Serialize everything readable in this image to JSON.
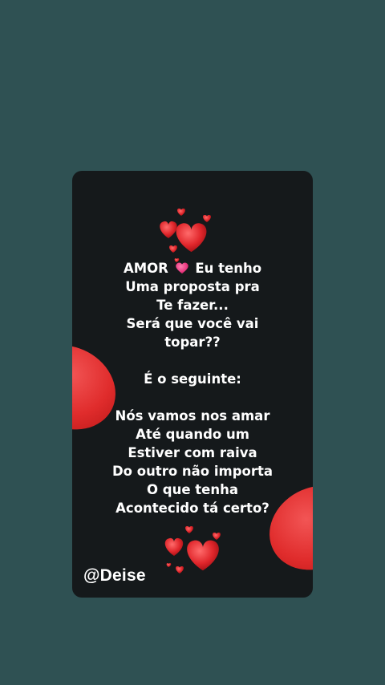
{
  "card": {
    "lines_block1": [
      "Uma proposta pra",
      "Te fazer...",
      "Será que você vai",
      "topar??"
    ],
    "first_line_start": "AMOR",
    "first_line_end": "Eu tenho",
    "line_block2": "É o seguinte:",
    "lines_block3": [
      "Nós vamos nos amar",
      "Até quando um",
      "Estiver com raiva",
      "Do outro não importa",
      "O que tenha",
      "Acontecido tá certo?"
    ],
    "watermark": "@Deise"
  },
  "icons": {
    "inline_heart": "pink-heart-icon",
    "decor_top": "red-hearts-cluster-icon",
    "decor_bottom": "red-hearts-cluster-icon"
  },
  "colors": {
    "background": "#2f5153",
    "card": "#15191b",
    "text": "#ffffff",
    "heart_red": "#e02c2c",
    "heart_pink": "#e8377e"
  }
}
